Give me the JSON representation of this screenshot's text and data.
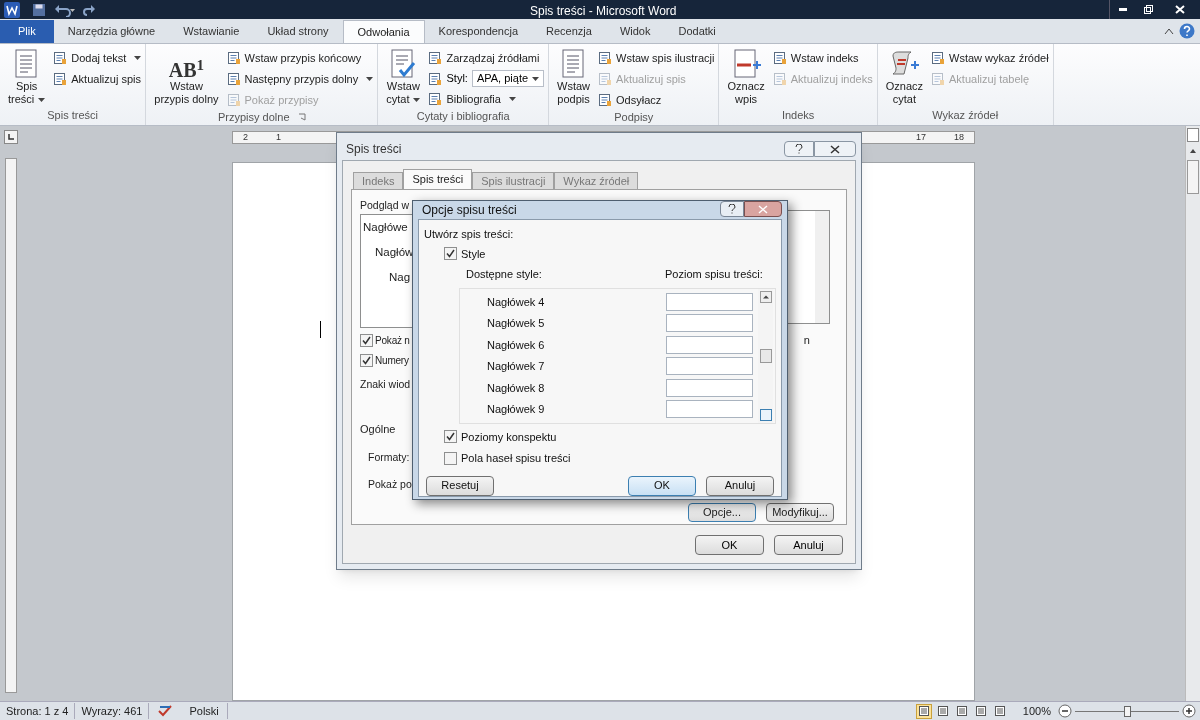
{
  "window": {
    "title": "Spis treści - Microsoft Word"
  },
  "ribbon_tabs": [
    {
      "label": "Plik",
      "kind": "file",
      "selected": false
    },
    {
      "label": "Narzędzia główne",
      "kind": "tab",
      "selected": false
    },
    {
      "label": "Wstawianie",
      "kind": "tab",
      "selected": false
    },
    {
      "label": "Układ strony",
      "kind": "tab",
      "selected": false
    },
    {
      "label": "Odwołania",
      "kind": "tab",
      "selected": true
    },
    {
      "label": "Korespondencja",
      "kind": "tab",
      "selected": false
    },
    {
      "label": "Recenzja",
      "kind": "tab",
      "selected": false
    },
    {
      "label": "Widok",
      "kind": "tab",
      "selected": false
    },
    {
      "label": "Dodatki",
      "kind": "tab",
      "selected": false
    }
  ],
  "ribbon_groups": [
    {
      "name": "Spis treści",
      "launcher": false,
      "large": [
        {
          "lines": [
            "Spis",
            "treści"
          ],
          "dropdown": true,
          "kind": "doc"
        }
      ],
      "small": [
        {
          "label": "Dodaj tekst",
          "dropdown": true,
          "disabled": false,
          "kind": "button"
        },
        {
          "label": "Aktualizuj spis",
          "dropdown": false,
          "disabled": false,
          "kind": "button"
        }
      ]
    },
    {
      "name": "Przypisy dolne",
      "launcher": true,
      "large": [
        {
          "lines": [
            "Wstaw",
            "przypis dolny"
          ],
          "dropdown": false,
          "kind": "text",
          "icon_text": "AB$^{1}$"
        }
      ],
      "small": [
        {
          "label": "Wstaw przypis końcowy",
          "dropdown": false,
          "disabled": false,
          "kind": "button"
        },
        {
          "label": "Następny przypis dolny",
          "dropdown": true,
          "disabled": false,
          "kind": "button"
        },
        {
          "label": "Pokaż przypisy",
          "dropdown": false,
          "disabled": true,
          "kind": "button"
        }
      ]
    },
    {
      "name": "Cytaty i bibliografia",
      "launcher": false,
      "large": [
        {
          "lines": [
            "Wstaw",
            "cytat"
          ],
          "dropdown": true,
          "kind": "check"
        }
      ],
      "small": [
        {
          "label": "Zarządzaj źródłami",
          "dropdown": false,
          "disabled": false,
          "kind": "button"
        },
        {
          "label": "Styl:",
          "value": "APA, piąte",
          "dropdown": true,
          "kind": "combo"
        },
        {
          "label": "Bibliografia",
          "dropdown": true,
          "disabled": false,
          "kind": "button"
        }
      ]
    },
    {
      "name": "Podpisy",
      "launcher": false,
      "large": [
        {
          "lines": [
            "Wstaw",
            "podpis"
          ],
          "dropdown": false,
          "kind": "doc"
        }
      ],
      "small": [
        {
          "label": "Wstaw spis ilustracji",
          "dropdown": false,
          "disabled": false,
          "kind": "button"
        },
        {
          "label": "Aktualizuj spis",
          "dropdown": false,
          "disabled": true,
          "kind": "button"
        },
        {
          "label": "Odsyłacz",
          "dropdown": false,
          "disabled": false,
          "kind": "button"
        }
      ]
    },
    {
      "name": "Indeks",
      "launcher": false,
      "large": [
        {
          "lines": [
            "Oznacz",
            "wpis"
          ],
          "dropdown": false,
          "kind": "mark"
        }
      ],
      "small": [
        {
          "label": "Wstaw indeks",
          "dropdown": false,
          "disabled": false,
          "kind": "button"
        },
        {
          "label": "Aktualizuj indeks",
          "dropdown": false,
          "disabled": true,
          "kind": "button"
        }
      ]
    },
    {
      "name": "Wykaz źródeł",
      "launcher": false,
      "large": [
        {
          "lines": [
            "Oznacz",
            "cytat"
          ],
          "dropdown": false,
          "kind": "scroll"
        }
      ],
      "small": [
        {
          "label": "Wstaw wykaz źródeł",
          "dropdown": false,
          "disabled": false,
          "kind": "button"
        },
        {
          "label": "Aktualizuj tabelę",
          "dropdown": false,
          "disabled": true,
          "kind": "button"
        }
      ]
    }
  ],
  "ruler": {
    "left_labels": [
      "2",
      "1"
    ],
    "right_labels": [
      "17",
      "18"
    ]
  },
  "toc_dialog": {
    "title": "Spis treści",
    "tabs": [
      {
        "label": "Indeks",
        "selected": false
      },
      {
        "label": "Spis treści",
        "selected": true
      },
      {
        "label": "Spis ilustracji",
        "selected": false
      },
      {
        "label": "Wykaz źródeł",
        "selected": false
      }
    ],
    "preview_label": "Podgląd w",
    "preview_lines": [
      "Nagłówe",
      "Nagłów",
      "Nag"
    ],
    "checkboxes": [
      {
        "label": "Pokaż n",
        "checked": true
      },
      {
        "label": "Numery",
        "checked": true
      }
    ],
    "leader_label": "Znaki wiod",
    "right_fragment": "n",
    "general_label": "Ogólne",
    "general_fields": [
      "Formaty:",
      "Pokaż po"
    ],
    "pane_buttons": [
      {
        "label": "Opcje...",
        "focused": true
      },
      {
        "label": "Modyfikuj...",
        "focused": false
      }
    ],
    "buttons": [
      "OK",
      "Anuluj"
    ]
  },
  "options_dialog": {
    "title": "Opcje spisu treści",
    "section_label": "Utwórz spis treści:",
    "styles_checkbox": {
      "label": "Style",
      "checked": true
    },
    "column_styles": "Dostępne style:",
    "column_level": "Poziom spisu treści:",
    "styles": [
      {
        "name": "Nagłówek 4"
      },
      {
        "name": "Nagłówek 5"
      },
      {
        "name": "Nagłówek 6"
      },
      {
        "name": "Nagłówek 7"
      },
      {
        "name": "Nagłówek 8"
      },
      {
        "name": "Nagłówek 9"
      }
    ],
    "checkboxes": [
      {
        "label": "Poziomy konspektu",
        "checked": true
      },
      {
        "label": "Pola haseł spisu treści",
        "checked": false
      }
    ],
    "buttons": [
      {
        "label": "Resetuj",
        "default": false
      },
      {
        "label": "OK",
        "default": true
      },
      {
        "label": "Anuluj",
        "default": false
      }
    ]
  },
  "status_bar": {
    "page": "Strona: 1 z 4",
    "words": "Wyrazy: 461",
    "language": "Polski",
    "views": [
      {
        "selected": true
      },
      {
        "selected": false
      },
      {
        "selected": false
      },
      {
        "selected": false
      },
      {
        "selected": false
      }
    ],
    "zoom": "100%",
    "zoom_slider": {
      "level": 0.5
    }
  }
}
